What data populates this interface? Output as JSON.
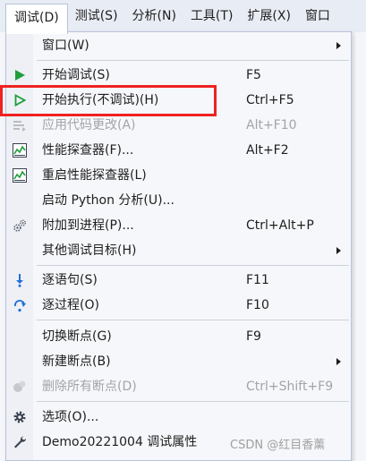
{
  "menubar": {
    "items": [
      {
        "label": "调试(D)"
      },
      {
        "label": "测试(S)"
      },
      {
        "label": "分析(N)"
      },
      {
        "label": "工具(T)"
      },
      {
        "label": "扩展(X)"
      },
      {
        "label": "窗口"
      }
    ]
  },
  "menu": {
    "items": [
      {
        "label": "窗口(W)",
        "shortcut": "",
        "icon": "none",
        "submenu": true,
        "enabled": true
      },
      {
        "label": "开始调试(S)",
        "shortcut": "F5",
        "icon": "play-icon-filled",
        "submenu": false,
        "enabled": true
      },
      {
        "label": "开始执行(不调试)(H)",
        "shortcut": "Ctrl+F5",
        "icon": "play-icon-outline",
        "submenu": false,
        "enabled": true
      },
      {
        "label": "应用代码更改(A)",
        "shortcut": "Alt+F10",
        "icon": "apply-code-icon",
        "submenu": false,
        "enabled": false
      },
      {
        "label": "性能探查器(F)...",
        "shortcut": "Alt+F2",
        "icon": "performance-icon",
        "submenu": false,
        "enabled": true
      },
      {
        "label": "重启性能探查器(L)",
        "shortcut": "",
        "icon": "performance-icon",
        "submenu": false,
        "enabled": true
      },
      {
        "label": "启动 Python 分析(U)...",
        "shortcut": "",
        "icon": "none",
        "submenu": false,
        "enabled": true
      },
      {
        "label": "附加到进程(P)...",
        "shortcut": "Ctrl+Alt+P",
        "icon": "gears-icon",
        "submenu": false,
        "enabled": true
      },
      {
        "label": "其他调试目标(H)",
        "shortcut": "",
        "icon": "none",
        "submenu": true,
        "enabled": true
      },
      {
        "label": "逐语句(S)",
        "shortcut": "F11",
        "icon": "step-into-icon",
        "submenu": false,
        "enabled": true
      },
      {
        "label": "逐过程(O)",
        "shortcut": "F10",
        "icon": "step-over-icon",
        "submenu": false,
        "enabled": true
      },
      {
        "label": "切换断点(G)",
        "shortcut": "F9",
        "icon": "none",
        "submenu": false,
        "enabled": true
      },
      {
        "label": "新建断点(B)",
        "shortcut": "",
        "icon": "none",
        "submenu": true,
        "enabled": true
      },
      {
        "label": "删除所有断点(D)",
        "shortcut": "Ctrl+Shift+F9",
        "icon": "delete-breakpoints-icon",
        "submenu": false,
        "enabled": false
      },
      {
        "label": "选项(O)...",
        "shortcut": "",
        "icon": "gear-icon",
        "submenu": false,
        "enabled": true
      },
      {
        "label": "Demo20221004 调试属性",
        "shortcut": "",
        "icon": "wrench-icon",
        "submenu": false,
        "enabled": true
      }
    ]
  },
  "watermark": "CSDN @红目香薰",
  "colors": {
    "highlight": "#ef2121",
    "play_green": "#1f9e3b",
    "step_blue": "#1e6fd9"
  }
}
